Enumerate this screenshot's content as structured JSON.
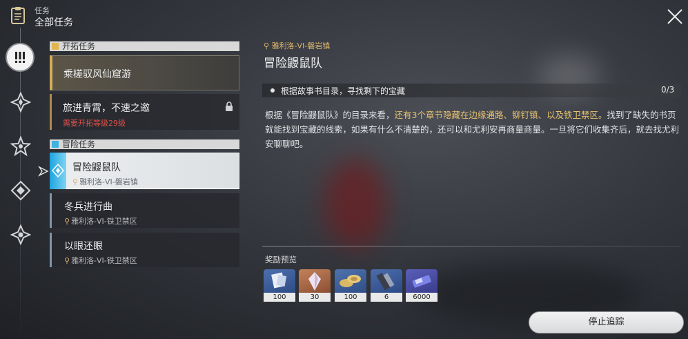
{
  "header": {
    "small_title": "任务",
    "title": "全部任务"
  },
  "sections": {
    "trailblaze": "开拓任务",
    "adventure": "冒险任务"
  },
  "quests": {
    "main": {
      "title": "乘槎驭风仙窟游"
    },
    "locked": {
      "title": "旅进青霄，不速之邀",
      "requirement": "需要开拓等级29级"
    },
    "selected": {
      "title": "冒险鼹鼠队",
      "location": "雅利洛-VI-磐岩镇"
    },
    "item2": {
      "title": "冬兵进行曲",
      "location": "雅利洛-VI-铁卫禁区"
    },
    "item3": {
      "title": "以眼还眼",
      "location": "雅利洛-VI-铁卫禁区"
    }
  },
  "detail": {
    "location": "雅利洛-VI-磐岩镇",
    "name": "冒险鼹鼠队",
    "objective": "根据故事书目录，寻找剩下的宝藏",
    "progress": "0/3",
    "desc_1": "根据《冒险鼹鼠队》的目录来看，",
    "desc_hl": "还有3个章节隐藏在边缘通路、铆钉镇、以及铁卫禁区。",
    "desc_2": "找到了缺失的书页就能找到宝藏的线索，如果有什么不清楚的，还可以和尤利安再商量商量。一旦将它们收集齐后，就去找尤利安聊聊吧。"
  },
  "rewards": {
    "label": "奖励预览",
    "items": [
      {
        "count": "100",
        "icon": "trailblaze-exp-icon"
      },
      {
        "count": "30",
        "icon": "stellar-jade-icon"
      },
      {
        "count": "100",
        "icon": "credit-coins-icon"
      },
      {
        "count": "6",
        "icon": "material-icon"
      },
      {
        "count": "6000",
        "icon": "exp-card-icon"
      }
    ]
  },
  "actions": {
    "stop_tracking": "停止追踪"
  },
  "colors": {
    "accent_gold": "#d5ac5b",
    "highlight": "#e5c170",
    "active_blue": "#1ea4e0",
    "locked_red": "#e0504a"
  }
}
